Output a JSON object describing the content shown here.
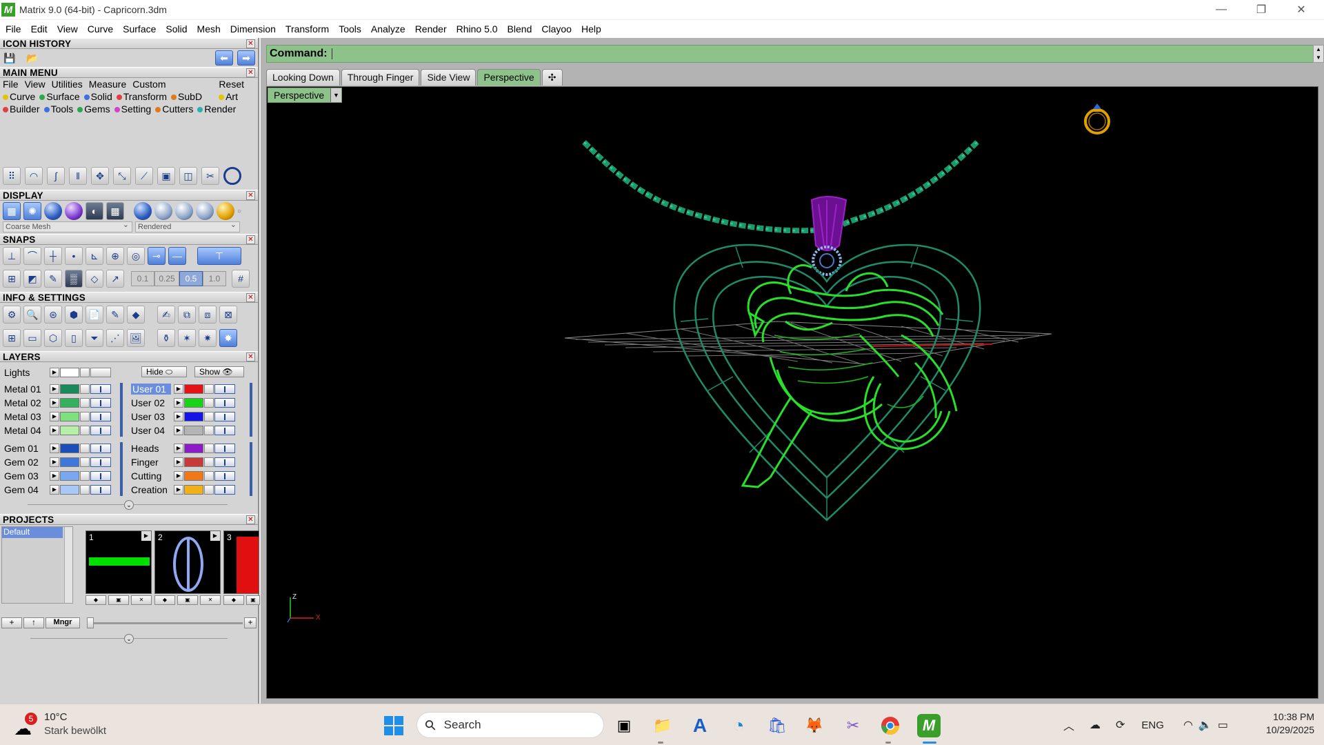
{
  "window": {
    "title": "Matrix 9.0 (64-bit) - Capricorn.3dm",
    "logo_icon": "matrix-logo-icon"
  },
  "menubar": [
    "File",
    "Edit",
    "View",
    "Curve",
    "Surface",
    "Solid",
    "Mesh",
    "Dimension",
    "Transform",
    "Tools",
    "Analyze",
    "Render",
    "Rhino 5.0",
    "Blend",
    "Clayoo",
    "Help"
  ],
  "panels": {
    "icon_history": "ICON HISTORY",
    "main_menu": "MAIN MENU",
    "display": "DISPLAY",
    "snaps": "SNAPS",
    "info_settings": "INFO & SETTINGS",
    "layers": "LAYERS",
    "projects": "PROJECTS"
  },
  "main_menu": {
    "top": [
      "File",
      "View",
      "Utilities",
      "Measure",
      "Custom"
    ],
    "reset": "Reset",
    "row1": [
      {
        "label": "Curve",
        "color": "#e6c300"
      },
      {
        "label": "Surface",
        "color": "#2aa84a"
      },
      {
        "label": "Solid",
        "color": "#3d6fe0"
      },
      {
        "label": "Transform",
        "color": "#e04040"
      },
      {
        "label": "SubD",
        "color": "#e07a1a"
      },
      {
        "label": "Art",
        "color": "#e6c300"
      }
    ],
    "row2": [
      {
        "label": "Builder",
        "color": "#e04040"
      },
      {
        "label": "Tools",
        "color": "#3d6fe0"
      },
      {
        "label": "Gems",
        "color": "#2aa84a"
      },
      {
        "label": "Setting",
        "color": "#d045c8"
      },
      {
        "label": "Cutters",
        "color": "#e07a1a"
      },
      {
        "label": "Render",
        "color": "#2ab0b0"
      }
    ]
  },
  "display": {
    "mesh_mode": "Coarse Mesh",
    "render_mode": "Rendered"
  },
  "snaps": {
    "values": [
      "0.1",
      "0.25",
      "0.5",
      "1.0"
    ],
    "selected": "0.5"
  },
  "layers": {
    "lights": "Lights",
    "hide": "Hide",
    "show": "Show",
    "left": [
      {
        "name": "Metal 01",
        "color": "#1a8a5a"
      },
      {
        "name": "Metal 02",
        "color": "#32b060"
      },
      {
        "name": "Metal 03",
        "color": "#7ee07e"
      },
      {
        "name": "Metal 04",
        "color": "#b6f0a8"
      },
      {
        "name": "Gem 01",
        "color": "#1c4eb8"
      },
      {
        "name": "Gem 02",
        "color": "#3f78d8"
      },
      {
        "name": "Gem 03",
        "color": "#7aa8f0"
      },
      {
        "name": "Gem 04",
        "color": "#a8c8f8"
      }
    ],
    "right": [
      {
        "name": "User 01",
        "color": "#e41414",
        "selected": true
      },
      {
        "name": "User 02",
        "color": "#18d418"
      },
      {
        "name": "User 03",
        "color": "#1414e4"
      },
      {
        "name": "User 04",
        "color": "#b4b4b4"
      },
      {
        "name": "Heads",
        "color": "#8c1cc8"
      },
      {
        "name": "Finger",
        "color": "#c83a3a"
      },
      {
        "name": "Cutting",
        "color": "#f07818"
      },
      {
        "name": "Creation",
        "color": "#f0b018"
      }
    ]
  },
  "projects": {
    "list": [
      "Default"
    ],
    "thumbs": [
      "1",
      "2",
      "3"
    ],
    "mngr": "Mngr"
  },
  "command": {
    "label": "Command:",
    "value": ""
  },
  "tabs": [
    "Looking Down",
    "Through Finger",
    "Side View",
    "Perspective"
  ],
  "active_tab": "Perspective",
  "viewport": {
    "label": "Perspective",
    "axis_z": "Z",
    "axis_x": "X"
  },
  "taskbar": {
    "weather_temp": "10°C",
    "weather_desc": "Stark bewölkt",
    "weather_badge": "5",
    "search_placeholder": "Search",
    "language": "ENG",
    "time": "10:38 PM",
    "date": "10/29/2025"
  }
}
